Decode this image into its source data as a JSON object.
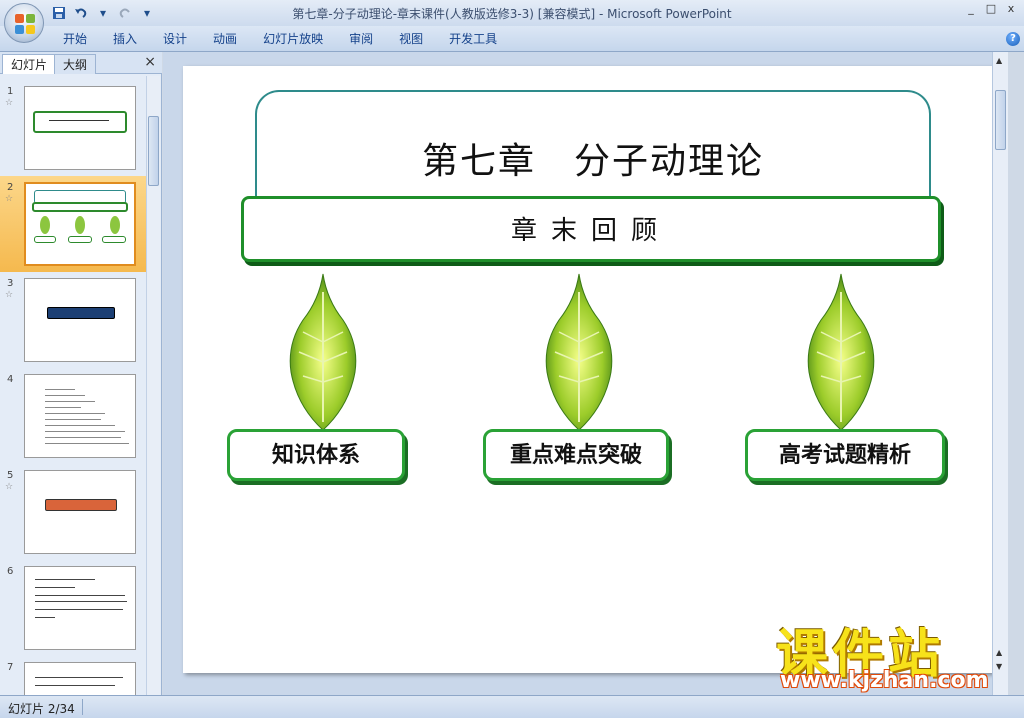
{
  "window": {
    "title": "第七章-分子动理论-章末课件(人教版选修3-3) [兼容模式]  -  Microsoft PowerPoint",
    "minimize": "_",
    "maximize": "□",
    "close": "x"
  },
  "quick_access": {
    "save_icon": "save-icon",
    "undo_icon": "undo-icon",
    "redo_icon": "redo-icon",
    "dropdown": "▾"
  },
  "ribbon": {
    "tabs": [
      "开始",
      "插入",
      "设计",
      "动画",
      "幻灯片放映",
      "审阅",
      "视图",
      "开发工具"
    ],
    "help": "?"
  },
  "left_pane": {
    "tab_slides": "幻灯片",
    "tab_outline": "大纲",
    "close": "×",
    "slides": [
      {
        "num": "1",
        "star": "☆"
      },
      {
        "num": "2",
        "star": "☆"
      },
      {
        "num": "3",
        "star": "☆"
      },
      {
        "num": "4",
        "star": ""
      },
      {
        "num": "5",
        "star": "☆"
      },
      {
        "num": "6",
        "star": ""
      },
      {
        "num": "7",
        "star": ""
      }
    ]
  },
  "slide": {
    "title": "第七章　分子动理论",
    "subtitle": "章末回顾",
    "topics": [
      "知识体系",
      "重点难点突破",
      "高考试题精析"
    ]
  },
  "watermark": {
    "brand": "课件站",
    "url": "www.kjzhan.com"
  },
  "status": {
    "slide_indicator": "幻灯片 2/34"
  },
  "colors": {
    "accent_green": "#1f8f2a",
    "title_teal": "#2e8b8b",
    "selected_thumb": "#f5b94e"
  }
}
